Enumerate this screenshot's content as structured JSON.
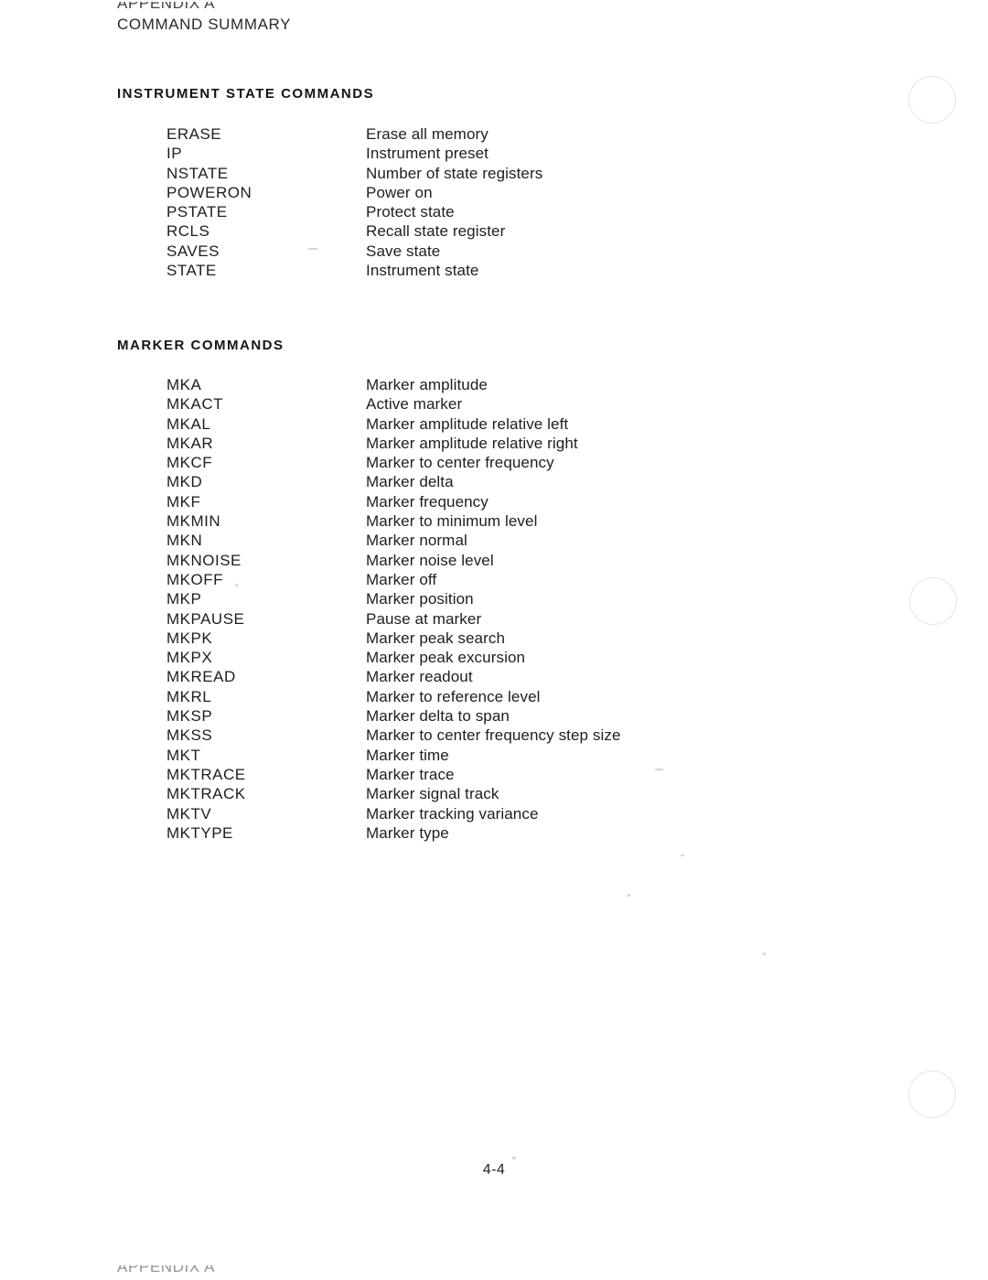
{
  "document": {
    "header": {
      "line1": "APPENDIX A",
      "line2": "COMMAND SUMMARY"
    },
    "page_number": "4-4",
    "footer_bleed": "APPENDIX A"
  },
  "sections": [
    {
      "heading": "INSTRUMENT STATE COMMANDS",
      "commands": [
        {
          "name": "ERASE",
          "description": "Erase all memory"
        },
        {
          "name": "IP",
          "description": "Instrument preset"
        },
        {
          "name": "NSTATE",
          "description": "Number of state registers"
        },
        {
          "name": "POWERON",
          "description": "Power on"
        },
        {
          "name": "PSTATE",
          "description": "Protect state"
        },
        {
          "name": "RCLS",
          "description": "Recall state register"
        },
        {
          "name": "SAVES",
          "description": "Save state"
        },
        {
          "name": "STATE",
          "description": "Instrument state"
        }
      ]
    },
    {
      "heading": "MARKER COMMANDS",
      "commands": [
        {
          "name": "MKA",
          "description": "Marker amplitude"
        },
        {
          "name": "MKACT",
          "description": "Active marker"
        },
        {
          "name": "MKAL",
          "description": "Marker amplitude relative left"
        },
        {
          "name": "MKAR",
          "description": "Marker amplitude relative right"
        },
        {
          "name": "MKCF",
          "description": "Marker to center frequency"
        },
        {
          "name": "MKD",
          "description": "Marker delta"
        },
        {
          "name": "MKF",
          "description": "Marker frequency"
        },
        {
          "name": "MKMIN",
          "description": "Marker to minimum level"
        },
        {
          "name": "MKN",
          "description": "Marker normal"
        },
        {
          "name": "MKNOISE",
          "description": "Marker noise level"
        },
        {
          "name": "MKOFF",
          "description": "Marker off"
        },
        {
          "name": "MKP",
          "description": "Marker position"
        },
        {
          "name": "MKPAUSE",
          "description": "Pause at marker"
        },
        {
          "name": "MKPK",
          "description": "Marker peak search"
        },
        {
          "name": "MKPX",
          "description": "Marker peak excursion"
        },
        {
          "name": "MKREAD",
          "description": "Marker readout"
        },
        {
          "name": "MKRL",
          "description": "Marker to reference level"
        },
        {
          "name": "MKSP",
          "description": "Marker delta to span"
        },
        {
          "name": "MKSS",
          "description": "Marker to center frequency step size"
        },
        {
          "name": "MKT",
          "description": "Marker time"
        },
        {
          "name": "MKTRACE",
          "description": "Marker trace"
        },
        {
          "name": "MKTRACK",
          "description": "Marker signal track"
        },
        {
          "name": "MKTV",
          "description": "Marker tracking variance"
        },
        {
          "name": "MKTYPE",
          "description": "Marker type"
        }
      ]
    }
  ]
}
